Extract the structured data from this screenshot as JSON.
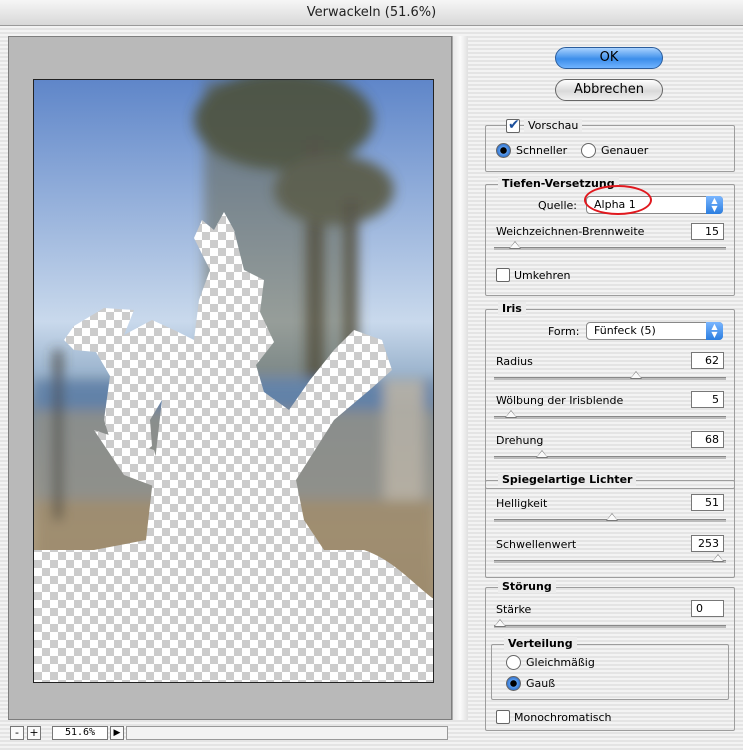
{
  "window": {
    "title": "Verwackeln (51.6%)"
  },
  "buttons": {
    "ok": "OK",
    "cancel": "Abbrechen"
  },
  "preview_group": {
    "preview_label": "Vorschau",
    "preview_checked": true,
    "mode_fast": "Schneller",
    "mode_accurate": "Genauer",
    "selected_mode": "Schneller"
  },
  "depth_map": {
    "title": "Tiefen-Versetzung",
    "source_label": "Quelle:",
    "source_value": "Alpha 1",
    "blur_focal_label": "Weichzeichnen-Brennweite",
    "blur_focal_value": "15",
    "blur_focal_level": 0.07,
    "invert_label": "Umkehren",
    "invert_checked": false
  },
  "iris": {
    "title": "Iris",
    "shape_label": "Form:",
    "shape_value": "Fünfeck (5)",
    "radius_label": "Radius",
    "radius_value": "62",
    "radius_level": 0.62,
    "curvature_label": "Wölbung der Irisblende",
    "curvature_value": "5",
    "curvature_level": 0.05,
    "rotation_label": "Drehung",
    "rotation_value": "68",
    "rotation_level": 0.19
  },
  "specular": {
    "title": "Spiegelartige Lichter",
    "brightness_label": "Helligkeit",
    "brightness_value": "51",
    "brightness_level": 0.51,
    "threshold_label": "Schwellenwert",
    "threshold_value": "253",
    "threshold_level": 0.99
  },
  "noise": {
    "title": "Störung",
    "amount_label": "Stärke",
    "amount_value": "0",
    "amount_level": 0.0,
    "distribution_title": "Verteilung",
    "uniform_label": "Gleichmäßig",
    "gaussian_label": "Gauß",
    "selected_distribution": "Gauß",
    "mono_label": "Monochromatisch",
    "mono_checked": false
  },
  "zoom": {
    "minus": "-",
    "plus": "+",
    "value": "51.6%"
  },
  "colors": {
    "highlight": "#e0181e",
    "accent": "#3c8eea"
  }
}
